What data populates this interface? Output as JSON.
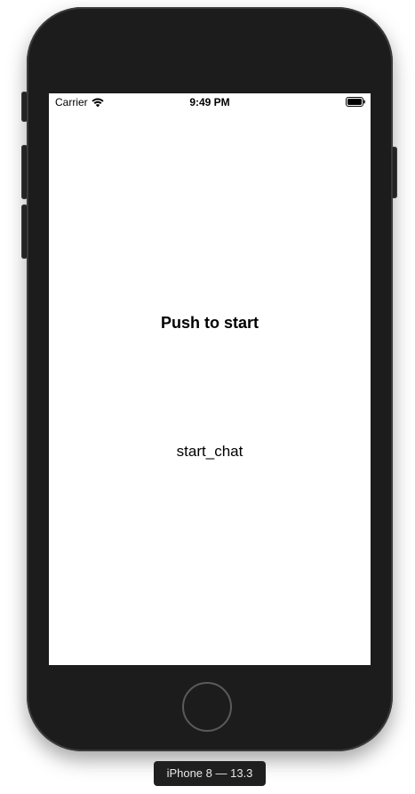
{
  "status_bar": {
    "carrier": "Carrier",
    "time": "9:49 PM",
    "wifi_icon": "wifi-icon",
    "battery_icon": "battery-icon"
  },
  "main": {
    "push_to_start_label": "Push to start",
    "start_chat_label": "start_chat"
  },
  "simulator": {
    "device_label": "iPhone 8 — 13.3"
  },
  "colors": {
    "device_body": "#1c1c1c",
    "screen_background": "#ffffff",
    "text": "#000000"
  }
}
